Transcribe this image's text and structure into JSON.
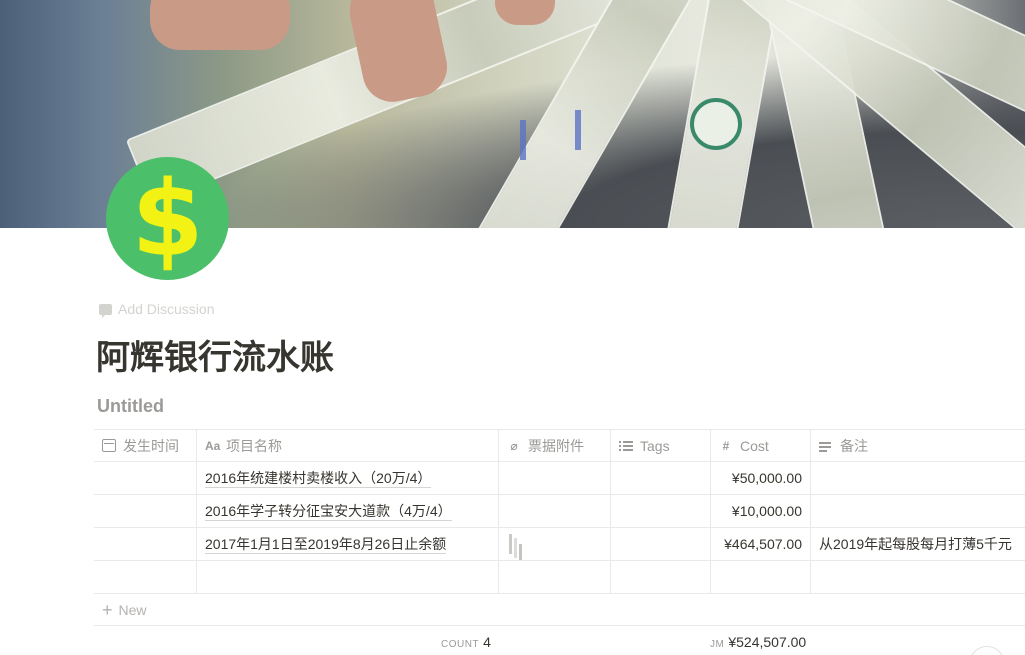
{
  "page": {
    "icon_glyph": "$",
    "discussion_label": "Add Discussion",
    "title": "阿辉银行流水账",
    "view_name": "Untitled"
  },
  "table": {
    "columns": [
      {
        "icon": "calendar-icon",
        "label": "发生时间"
      },
      {
        "icon": "text-icon",
        "label": "项目名称"
      },
      {
        "icon": "paperclip-icon",
        "label": "票据附件"
      },
      {
        "icon": "list-icon",
        "label": "Tags"
      },
      {
        "icon": "hash-icon",
        "label": "Cost"
      },
      {
        "icon": "lines-icon",
        "label": "备注"
      }
    ],
    "rows": [
      {
        "date": "",
        "name": "2016年统建楼村卖楼收入（20万/4）",
        "attachment": "",
        "tags": "",
        "cost": "¥50,000.00",
        "note": ""
      },
      {
        "date": "",
        "name": "2016年学子转分征宝安大道款（4万/4）",
        "attachment": "",
        "tags": "",
        "cost": "¥10,000.00",
        "note": ""
      },
      {
        "date": "",
        "name": "2017年1月1日至2019年8月26日止余额",
        "attachment": "thumbnail",
        "tags": "",
        "cost": "¥464,507.00",
        "note": "从2019年起每股每月打薄5千元"
      },
      {
        "date": "",
        "name": "",
        "attachment": "",
        "tags": "",
        "cost": "",
        "note": ""
      }
    ],
    "new_label": "New",
    "footer": {
      "count_label": "COUNT",
      "count_value": "4",
      "sum_label": "JM",
      "sum_value": "¥524,507.00"
    }
  },
  "colors": {
    "icon_bg": "#4cbf6a",
    "icon_glyph": "#f2f214",
    "text": "#37352f",
    "muted": "#9b9a97",
    "border": "#e9e9e7"
  }
}
